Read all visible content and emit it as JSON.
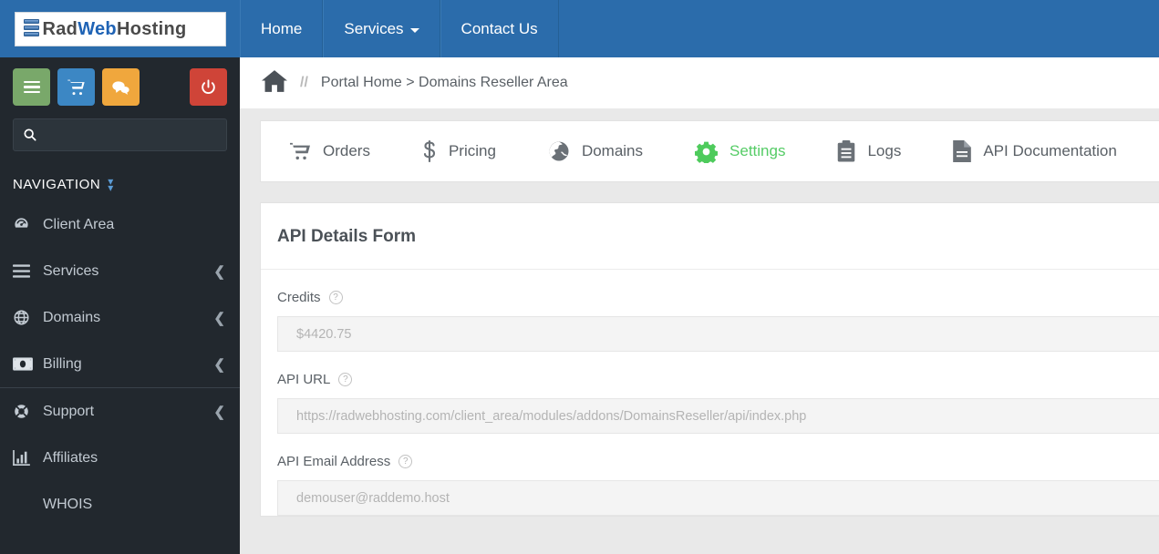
{
  "header": {
    "logo": {
      "part1": "Rad",
      "part2": "Web",
      "part3": "Hosting",
      "icon": "server-stack-icon"
    },
    "nav": [
      {
        "label": "Home",
        "icon": null,
        "caret": false
      },
      {
        "label": "Services",
        "icon": null,
        "caret": true
      },
      {
        "label": "Contact Us",
        "icon": null,
        "caret": false
      }
    ],
    "brand_color": "#2b6cab"
  },
  "sidebar": {
    "actions": [
      {
        "name": "menu-toggle-button",
        "icon": "hamburger-icon",
        "color": "#79a86a"
      },
      {
        "name": "cart-button",
        "icon": "shopping-cart-icon",
        "color": "#3c87c4"
      },
      {
        "name": "chat-button",
        "icon": "chat-bubbles-icon",
        "color": "#f0a73d"
      },
      {
        "name": "logout-button",
        "icon": "power-icon",
        "color": "#cf4438"
      }
    ],
    "search": {
      "placeholder": "",
      "value": "",
      "icon": "search-icon"
    },
    "nav_header": {
      "label": "NAVIGATION",
      "icon": "double-chevron-down-icon"
    },
    "items": [
      {
        "label": "Client Area",
        "icon": "dashboard-icon",
        "chevron": false
      },
      {
        "label": "Services",
        "icon": "hamburger-icon",
        "chevron": true
      },
      {
        "label": "Domains",
        "icon": "globe-icon",
        "chevron": true
      },
      {
        "label": "Billing",
        "icon": "money-bill-icon",
        "chevron": true
      },
      {
        "label": "Support",
        "icon": "lifebuoy-icon",
        "chevron": true
      },
      {
        "label": "Affiliates",
        "icon": "bar-chart-icon",
        "chevron": false
      },
      {
        "label": "WHOIS",
        "icon": null,
        "chevron": false
      }
    ],
    "background": "#22282e"
  },
  "breadcrumb": {
    "home_icon": "home-icon",
    "separator": "//",
    "text": "Portal Home > Domains Reseller Area"
  },
  "tabs": [
    {
      "label": "Orders",
      "icon": "shopping-cart-icon",
      "active": false
    },
    {
      "label": "Pricing",
      "icon": "dollar-sign-icon",
      "active": false
    },
    {
      "label": "Domains",
      "icon": "globe-icon",
      "active": false
    },
    {
      "label": "Settings",
      "icon": "gear-icon",
      "active": true
    },
    {
      "label": "Logs",
      "icon": "clipboard-icon",
      "active": false
    },
    {
      "label": "API Documentation",
      "icon": "document-icon",
      "active": false
    }
  ],
  "form": {
    "title": "API Details Form",
    "fields": [
      {
        "label": "Credits",
        "value": "$4420.75",
        "help_icon": "question-circle-icon"
      },
      {
        "label": "API URL",
        "value": "https://radwebhosting.com/client_area/modules/addons/DomainsReseller/api/index.php",
        "help_icon": "question-circle-icon"
      },
      {
        "label": "API Email Address",
        "value": "demouser@raddemo.host",
        "help_icon": "question-circle-icon"
      }
    ]
  },
  "colors": {
    "accent_green": "#55cc66",
    "brand_blue": "#2b6cab",
    "sidebar_dark": "#22282e"
  }
}
